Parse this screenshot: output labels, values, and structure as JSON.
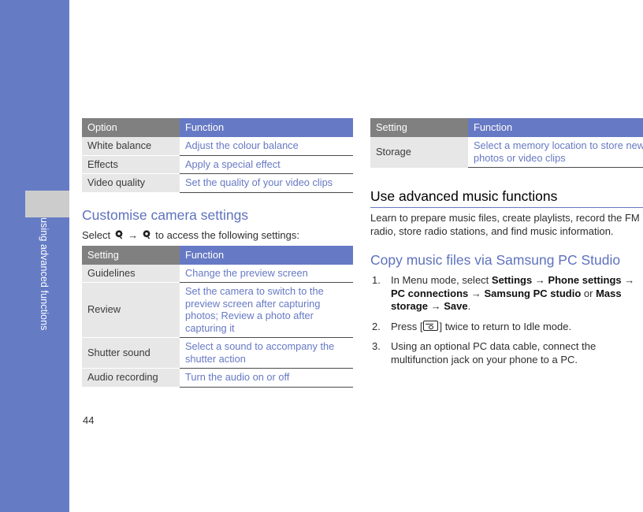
{
  "sidebar": {
    "label": "using advanced functions",
    "color": "#657CC5",
    "tab_color": "#CCCCCC"
  },
  "page": {
    "number": "44"
  },
  "colors": {
    "header_key_bg": "#808080",
    "header_value_bg": "#6679C4",
    "key_cell_bg": "#E7E7E7",
    "value_text": "#6679C4",
    "blue_heading": "#5E72BE"
  },
  "left_column": {
    "table_options": {
      "headers": [
        "Option",
        "Function"
      ],
      "rows": [
        [
          "White balance",
          "Adjust the colour balance"
        ],
        [
          "Effects",
          "Apply a special effect"
        ],
        [
          "Video quality",
          "Set the quality of your video clips"
        ]
      ]
    },
    "heading": "Customise camera settings",
    "select_line": {
      "prefix": "Select",
      "icon1": "gear-icon",
      "arrow": "→",
      "icon2": "gear-icon",
      "suffix": "to access the following settings:"
    },
    "table_settings": {
      "headers": [
        "Setting",
        "Function"
      ],
      "rows": [
        [
          "Guidelines",
          "Change the preview screen"
        ],
        [
          "Review",
          "Set the camera to switch to the preview screen after capturing photos; Review a photo after capturing it"
        ],
        [
          "Shutter sound",
          "Select a sound to accompany the shutter action"
        ],
        [
          "Audio recording",
          "Turn the audio on or off"
        ]
      ]
    }
  },
  "right_column": {
    "table_storage": {
      "headers": [
        "Setting",
        "Function"
      ],
      "rows": [
        [
          "Storage",
          "Select a memory location to store new photos or video clips"
        ]
      ]
    },
    "section_heading": "Use advanced music functions",
    "section_body": "Learn to prepare music files, create playlists, record the FM radio, store radio stations, and find music information.",
    "subsection_heading": "Copy music files via Samsung PC Studio",
    "steps": [
      {
        "parts": [
          {
            "t": "text",
            "v": "In Menu mode, select "
          },
          {
            "t": "bold",
            "v": "Settings"
          },
          {
            "t": "arrow",
            "v": " → "
          },
          {
            "t": "bold",
            "v": "Phone settings"
          },
          {
            "t": "arrow",
            "v": " → "
          },
          {
            "t": "bold",
            "v": "PC connections"
          },
          {
            "t": "arrow",
            "v": " → "
          },
          {
            "t": "bold",
            "v": "Samsung PC studio"
          },
          {
            "t": "text",
            "v": " or "
          },
          {
            "t": "bold",
            "v": "Mass storage"
          },
          {
            "t": "arrow",
            "v": " → "
          },
          {
            "t": "bold",
            "v": "Save"
          },
          {
            "t": "text",
            "v": "."
          }
        ]
      },
      {
        "parts": [
          {
            "t": "text",
            "v": "Press ["
          },
          {
            "t": "key",
            "v": "end-call-key-icon"
          },
          {
            "t": "text",
            "v": "] twice to return to Idle mode."
          }
        ]
      },
      {
        "parts": [
          {
            "t": "text",
            "v": "Using an optional PC data cable, connect the multifunction jack on your phone to a PC."
          }
        ]
      }
    ]
  }
}
